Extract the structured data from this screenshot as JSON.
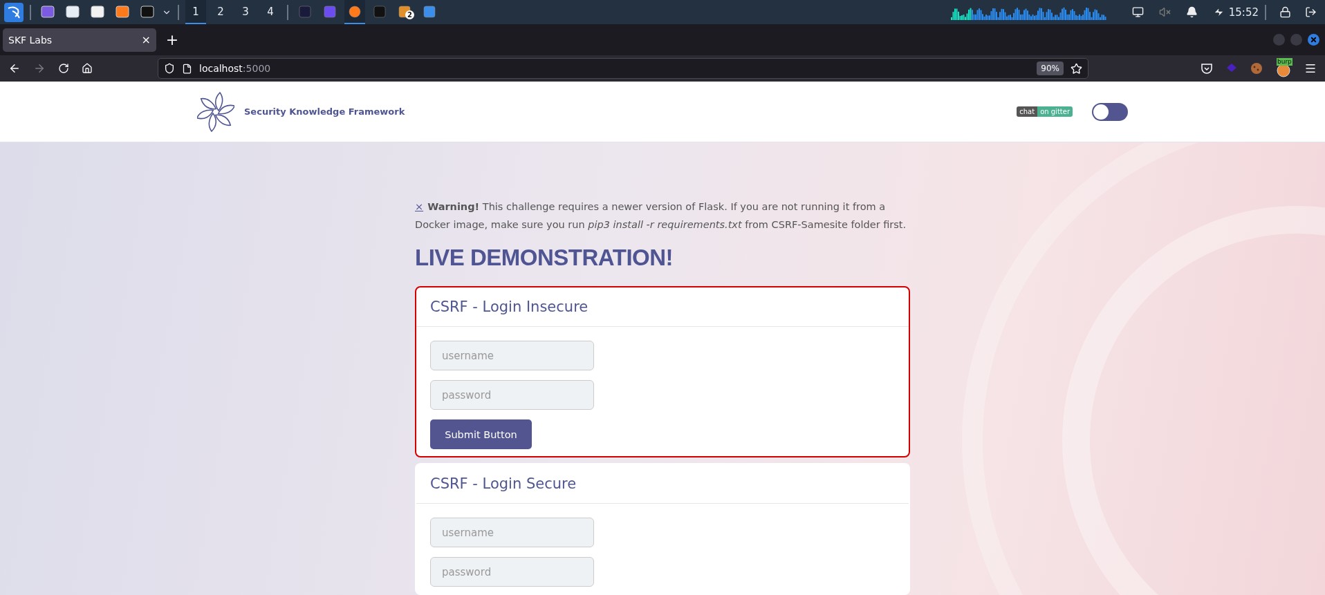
{
  "taskbar": {
    "workspaces": [
      {
        "label": "1",
        "selected": true
      },
      {
        "label": "2",
        "selected": false
      },
      {
        "label": "3",
        "selected": false
      },
      {
        "label": "4",
        "selected": false
      }
    ],
    "windows": [
      {
        "selected": false
      },
      {
        "selected": false
      },
      {
        "selected": true
      },
      {
        "selected": false
      },
      {
        "selected": false,
        "badge": "2"
      },
      {
        "selected": false
      }
    ],
    "clock": "15:52"
  },
  "browser": {
    "tab": {
      "title": "SKF Labs",
      "close": "×"
    },
    "new_tab": "+",
    "url": {
      "host": "localhost",
      "port": ":5000"
    },
    "zoom": "90%",
    "extension_badge": "burp"
  },
  "page": {
    "header": {
      "brand": "Security Knowledge Framework",
      "chat_badge": {
        "left": "chat",
        "right": "on gitter"
      },
      "theme_toggle": {
        "on": false
      }
    },
    "warning": {
      "close": "×",
      "text": "**Warning!** This challenge requires a newer version of Flask. If you are not running it from a Docker image, make sure you run *pip3 install -r requirements.txt* from CSRF-Samesite folder first."
    },
    "heading": "LIVE DEMONSTRATION!",
    "cards": [
      {
        "title": "CSRF - Login Insecure",
        "highlighted": true,
        "fields": [
          {
            "placeholder": "username"
          },
          {
            "placeholder": "password"
          }
        ],
        "button": "Submit Button"
      },
      {
        "title": "CSRF - Login Secure",
        "highlighted": false,
        "fields": [
          {
            "placeholder": "username"
          },
          {
            "placeholder": "password"
          }
        ]
      }
    ]
  }
}
